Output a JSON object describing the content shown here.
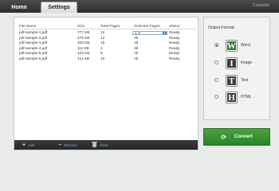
{
  "brand": "Coolutils",
  "tabs": {
    "home": "Home",
    "settings": "Settings"
  },
  "table": {
    "headers": {
      "name": "File Name",
      "size": "Size",
      "pages": "Total Pages",
      "selected": "Selected Pages",
      "status": "Status"
    },
    "rows": [
      {
        "name": "pdf-sample-1.pdf",
        "size": "777 KB",
        "pages": "12",
        "selected": "1-3",
        "status": "Ready"
      },
      {
        "name": "pdf-sample-2.pdf",
        "size": "275 KB",
        "pages": "12",
        "selected": "All",
        "status": "Ready"
      },
      {
        "name": "pdf-sample-3.pdf",
        "size": "303 KB",
        "pages": "15",
        "selected": "All",
        "status": "Ready"
      },
      {
        "name": "pdf-sample-4.pdf",
        "size": "111 KB",
        "pages": "2",
        "selected": "All",
        "status": "Ready"
      },
      {
        "name": "pdf-sample-5.pdf",
        "size": "423 KB",
        "pages": "5",
        "selected": "All",
        "status": "Ready"
      },
      {
        "name": "pdf-sample-6.pdf",
        "size": "411 KB",
        "pages": "10",
        "selected": "All",
        "status": "Ready"
      }
    ]
  },
  "toolbar": {
    "add": "Add",
    "remove": "Remove",
    "clear": "Clear",
    "add_icon": "plus-icon",
    "remove_icon": "minus-icon",
    "clear_icon": "trash-icon"
  },
  "output": {
    "title": "Output Format:",
    "selected": "Word",
    "options": [
      {
        "label": "Word",
        "glyph": "W",
        "checked": true,
        "icon": "word-icon"
      },
      {
        "label": "Image",
        "glyph": "I",
        "checked": false,
        "icon": "image-icon"
      },
      {
        "label": "Text",
        "glyph": "T",
        "checked": false,
        "icon": "text-icon"
      },
      {
        "label": "HTML",
        "glyph": "H",
        "checked": false,
        "icon": "html-icon"
      }
    ]
  },
  "convert": {
    "label": "Convert",
    "icon": "refresh-icon"
  },
  "colors": {
    "accent_green": "#2f8a2c",
    "top_bar": "#3a3a3a",
    "link_blue": "#7fa3d6"
  }
}
